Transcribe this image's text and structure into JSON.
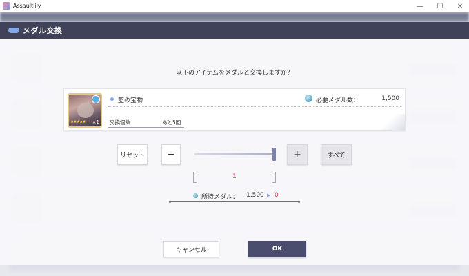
{
  "window": {
    "title": "Assaultlily",
    "minimize": "—",
    "maximize": "☐",
    "close": "✕"
  },
  "dialog": {
    "title": "メダル交換",
    "question": "以下のアイテムをメダルと交換しますか？",
    "item": {
      "name": "藍の宝物",
      "thumb_count": "×1",
      "thumb_stars": "★★★★★",
      "required_label": "必要メダル数：",
      "required_value": "1,500",
      "exchange_count_label": "交換個数",
      "remaining_label": "あと5回"
    },
    "controls": {
      "reset_label": "リセット",
      "minus_label": "−",
      "plus_label": "+",
      "all_label": "すべて",
      "quantity": "1",
      "slider_level": 1.0
    },
    "owned": {
      "label": "所持メダル：",
      "value": "1,500",
      "arrow": "▶",
      "after": "0"
    },
    "cancel_label": "キャンセル",
    "ok_label": "OK"
  },
  "colors": {
    "header": "#3f4258",
    "ok_button": "#4a4d6e",
    "accent_blue": "#86a7e8",
    "quantity_red": "#d43d3d"
  }
}
